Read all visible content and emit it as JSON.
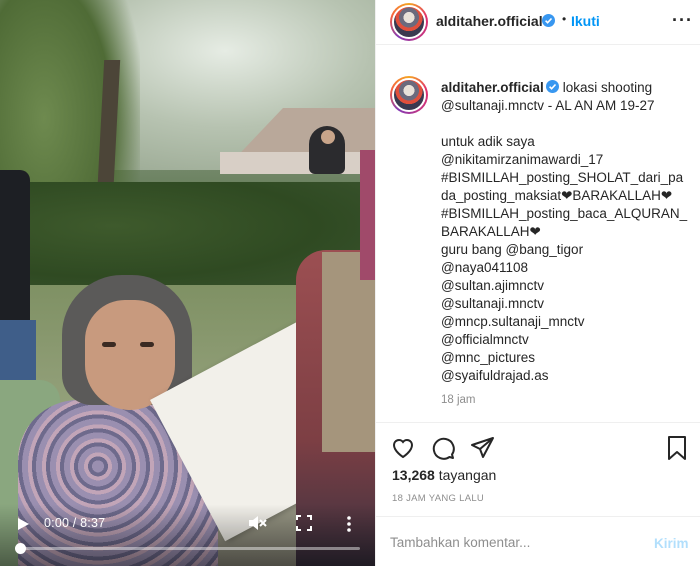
{
  "video": {
    "time": "0:00 / 8:37",
    "progress": 0.0
  },
  "header": {
    "username": "alditaher.official",
    "dot": "•",
    "follow_label": "Ikuti",
    "more": "···"
  },
  "caption": {
    "username": "alditaher.official",
    "lines": [
      "lokasi shooting",
      "@sultanaji.mnctv - AL AN AM 19-27",
      "",
      "untuk adik saya",
      "@nikitamirzanimawardi_17",
      "#BISMILLAH_posting_SHOLAT_dari_pa",
      "da_posting_maksiat❤BARAKALLAH❤",
      "#BISMILLAH_posting_baca_ALQURAN_",
      "BARAKALLAH❤",
      "guru bang @bang_tigor",
      "@naya041108",
      "@sultan.ajimnctv",
      "@sultanaji.mnctv",
      "@mncp.sultanaji_mnctv",
      "@officialmnctv",
      "@mnc_pictures",
      "@syaifuldrajad.as"
    ],
    "time_ago": "18 jam"
  },
  "stats": {
    "views_count": "13,268",
    "views_label": "tayangan",
    "date": "18 JAM YANG LALU"
  },
  "comment": {
    "placeholder": "Tambahkan komentar...",
    "post_label": "Kirim"
  },
  "colors": {
    "link": "#0095f6",
    "post_disabled": "#b2dffc",
    "muted": "#8e8e8e",
    "verified": "#3897f0"
  }
}
